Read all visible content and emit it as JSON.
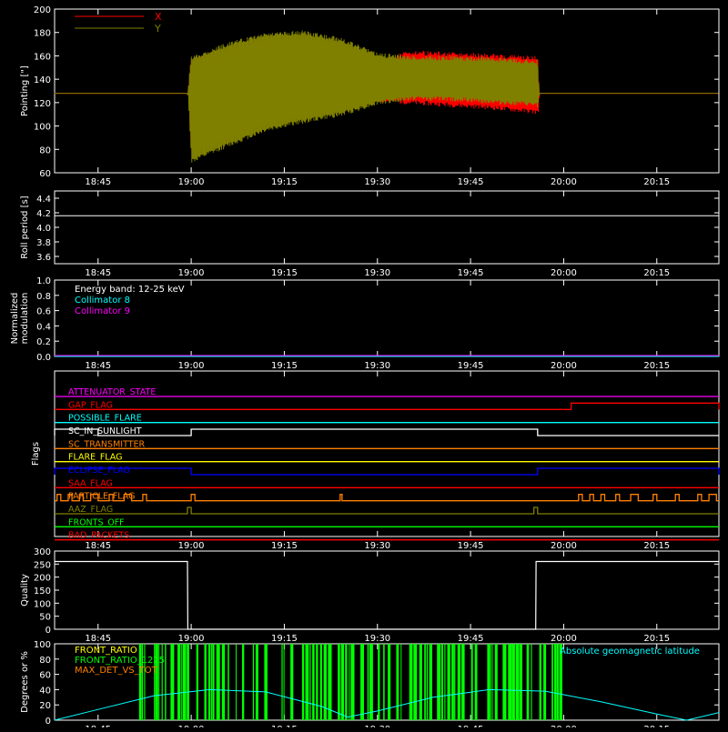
{
  "time_axis": {
    "range_hours": [
      18.6333,
      20.4167
    ],
    "tick_labels": [
      "18:45",
      "19:00",
      "19:15",
      "19:30",
      "19:45",
      "20:00",
      "20:15"
    ],
    "tick_values": [
      18.75,
      19.0,
      19.25,
      19.5,
      19.75,
      20.0,
      20.25
    ]
  },
  "colors": {
    "background": "#000000",
    "axes": "#ffffff",
    "pointing_x": "#ff0000",
    "pointing_y": "#808000",
    "roll": "#ffffff",
    "collimator8": "#00ffff",
    "collimator9": "#ff00ff",
    "quality": "#ffffff",
    "front_ratio": "#ffff00",
    "front_ratio_25": "#00ff00",
    "max_det": "#ff8000",
    "geomag": "#00ffff"
  },
  "chart_data": [
    {
      "type": "line",
      "ylabel": "Pointing [\"]",
      "ylim": [
        60,
        200
      ],
      "yticks": [
        "60",
        "80",
        "100",
        "120",
        "140",
        "160",
        "180",
        "200"
      ],
      "legend": [
        "X",
        "Y"
      ],
      "series": [
        {
          "name": "X",
          "x": [
            18.633,
            18.99,
            19.0,
            19.1,
            19.2,
            19.3,
            19.4,
            19.5,
            19.6,
            19.7,
            19.8,
            19.93,
            19.935,
            20.417
          ],
          "high": [
            128,
            128,
            158,
            168,
            175,
            168,
            160,
            158,
            165,
            163,
            162,
            160,
            128,
            128
          ],
          "low": [
            128,
            128,
            78,
            92,
            102,
            108,
            116,
            120,
            118,
            116,
            114,
            110,
            128,
            128
          ]
        },
        {
          "name": "Y",
          "x": [
            18.633,
            18.99,
            19.0,
            19.1,
            19.2,
            19.3,
            19.4,
            19.5,
            19.6,
            19.7,
            19.8,
            19.93,
            19.935,
            20.417
          ],
          "high": [
            128,
            128,
            160,
            172,
            180,
            182,
            176,
            163,
            160,
            160,
            159,
            157,
            128,
            128
          ],
          "low": [
            128,
            128,
            68,
            82,
            95,
            102,
            108,
            118,
            122,
            121,
            119,
            116,
            128,
            128
          ]
        }
      ]
    },
    {
      "type": "line",
      "ylabel": "Roll period [s]",
      "ylim": [
        3.5,
        4.5
      ],
      "yticks": [
        "3.6",
        "3.8",
        "4.0",
        "4.2",
        "4.4"
      ],
      "series": [
        {
          "x": [
            18.633,
            20.417
          ],
          "y": [
            4.16,
            4.16
          ]
        }
      ]
    },
    {
      "type": "line",
      "ylabel": [
        "Normalized",
        "modulation"
      ],
      "ylim": [
        0,
        1
      ],
      "yticks": [
        "0.0",
        "0.2",
        "0.4",
        "0.6",
        "0.8",
        "1.0"
      ],
      "annotations": [
        "Energy band: 12-25 keV",
        "Collimator 8",
        "Collimator 9"
      ],
      "series": [
        {
          "name": "Collimator 8",
          "x": [
            18.633,
            20.417
          ],
          "y": [
            0,
            0
          ]
        },
        {
          "name": "Collimator 9",
          "x": [
            18.633,
            20.417
          ],
          "y": [
            0,
            0
          ]
        }
      ]
    },
    {
      "type": "line",
      "ylabel": "Flags",
      "flags": [
        {
          "name": "ATTENUATOR_STATE",
          "color": "#ff00ff",
          "segments": []
        },
        {
          "name": "GAP_FLAG",
          "color": "#ff0000",
          "segments": [
            [
              20.02,
              20.417
            ]
          ]
        },
        {
          "name": "POSSIBLE_FLARE",
          "color": "#00ffff",
          "segments": []
        },
        {
          "name": "SC_IN_SUNLIGHT",
          "color": "#ffffff",
          "segments": [
            [
              18.633,
              18.75
            ],
            [
              19.0,
              19.93
            ]
          ]
        },
        {
          "name": "SC_TRANSMITTER",
          "color": "#ff8000",
          "segments": []
        },
        {
          "name": "FLARE_FLAG",
          "color": "#ffff00",
          "segments": []
        },
        {
          "name": "ECLIPSE_FLAG",
          "color": "#0000ff",
          "segments": [
            [
              18.633,
              19.0
            ],
            [
              19.93,
              20.417
            ]
          ]
        },
        {
          "name": "SAA_FLAG",
          "color": "#ff0000",
          "segments": []
        },
        {
          "name": "PARTICLE_FLAG",
          "color": "#ff8000",
          "segments": [
            [
              18.64,
              18.65
            ],
            [
              18.67,
              18.68
            ],
            [
              18.7,
              18.71
            ],
            [
              18.73,
              18.75
            ],
            [
              18.78,
              18.79
            ],
            [
              18.82,
              18.84
            ],
            [
              18.87,
              18.88
            ],
            [
              19.0,
              19.01
            ],
            [
              19.4,
              19.405
            ],
            [
              20.04,
              20.05
            ],
            [
              20.07,
              20.08
            ],
            [
              20.1,
              20.11
            ],
            [
              20.14,
              20.15
            ],
            [
              20.18,
              20.2
            ],
            [
              20.24,
              20.25
            ],
            [
              20.3,
              20.31
            ],
            [
              20.36,
              20.37
            ],
            [
              20.39,
              20.41
            ]
          ]
        },
        {
          "name": "AAZ_FLAG",
          "color": "#808000",
          "segments": [
            [
              18.99,
              19.0
            ],
            [
              19.92,
              19.93
            ]
          ]
        },
        {
          "name": "FRONTS_OFF",
          "color": "#00ff00",
          "segments": []
        },
        {
          "name": "BAD_PACKETS",
          "color": "#ff0000",
          "segments": []
        }
      ]
    },
    {
      "type": "line",
      "ylabel": "Quality",
      "ylim": [
        0,
        300
      ],
      "yticks": [
        "0",
        "50",
        "100",
        "150",
        "200",
        "250",
        "300"
      ],
      "series": [
        {
          "x": [
            18.633,
            18.99,
            18.991,
            19.925,
            19.926,
            20.417
          ],
          "y": [
            260,
            260,
            0,
            0,
            260,
            260
          ]
        }
      ]
    },
    {
      "type": "line",
      "ylabel": "Degrees or %",
      "ylim": [
        0,
        100
      ],
      "yticks": [
        "0",
        "20",
        "40",
        "60",
        "80",
        "100"
      ],
      "legend": [
        "FRONT_RATIO",
        "FRONT_RATIO_1225",
        "MAX_DET_VS_TOT",
        "Absolute geomagnetic latitude"
      ],
      "series": [
        {
          "name": "Absolute geomagnetic latitude",
          "x": [
            18.633,
            18.75,
            18.9,
            19.05,
            19.2,
            19.35,
            19.42,
            19.5,
            19.65,
            19.8,
            19.95,
            20.1,
            20.25,
            20.33,
            20.417
          ],
          "y": [
            0,
            14,
            32,
            40,
            37,
            18,
            4,
            12,
            30,
            40,
            38,
            24,
            8,
            0,
            10
          ]
        },
        {
          "name": "FRONT_RATIO_1225",
          "range": [
            18.86,
            20.0
          ]
        }
      ]
    }
  ]
}
